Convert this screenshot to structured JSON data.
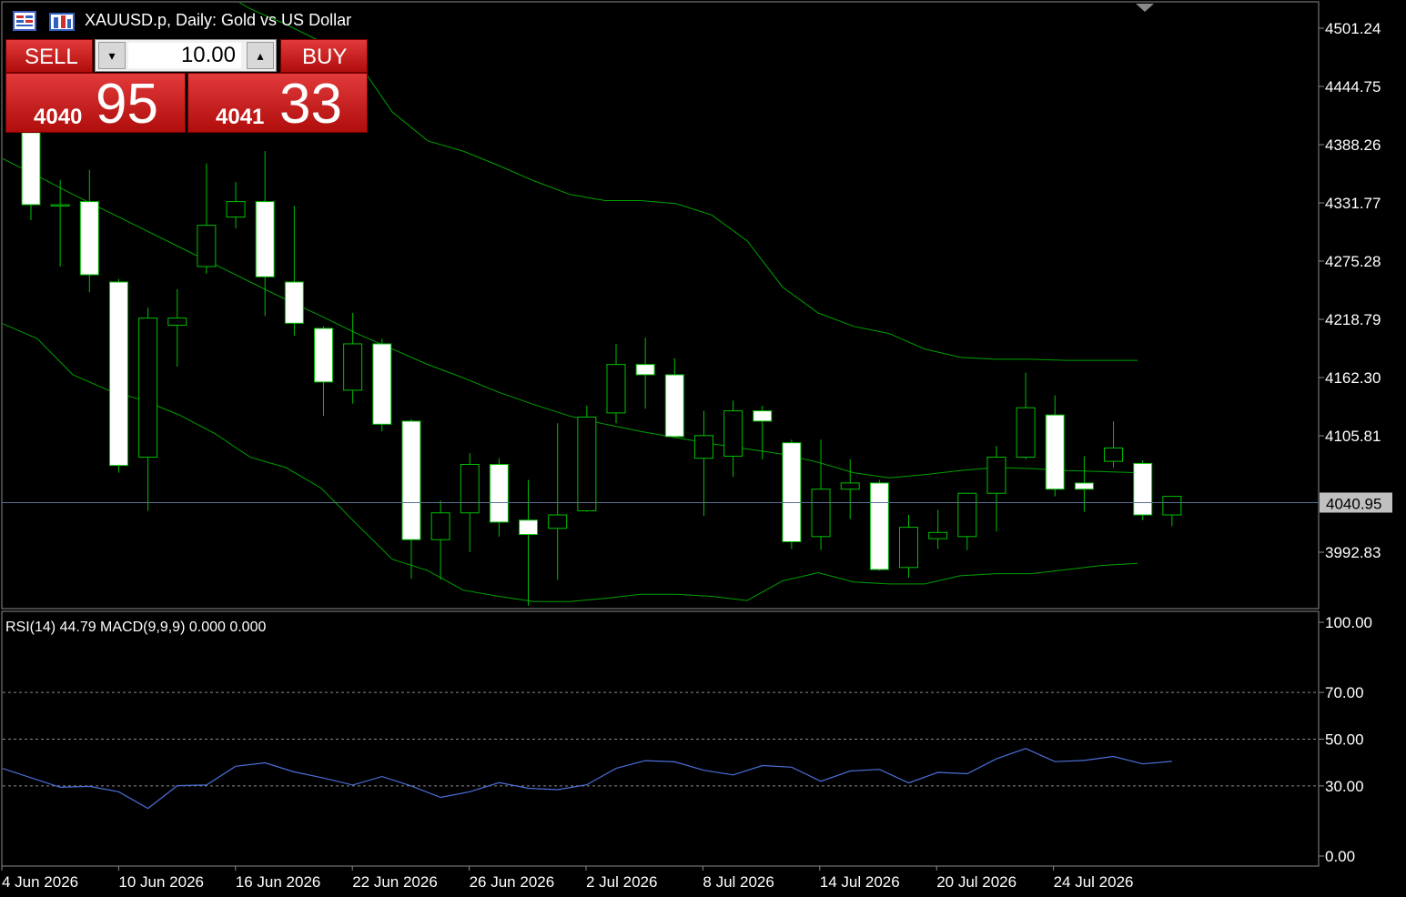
{
  "header": {
    "title": "XAUUSD.p, Daily:  Gold vs US Dollar"
  },
  "trade_panel": {
    "sell_label": "SELL",
    "buy_label": "BUY",
    "lot_value": "10.00",
    "sell_price_small": "4040",
    "sell_price_big": "95",
    "buy_price_small": "4041",
    "buy_price_big": "33"
  },
  "indicator": {
    "label": "RSI(14) 44.79 MACD(9,9,9) 0.000 0.000"
  },
  "colors": {
    "background": "#000000",
    "candle_bull": "#000000",
    "candle_bear": "#ffffff",
    "candle_outline": "#00c000",
    "bands": "#00a000",
    "rsi": "#4a6fd8",
    "current_price_line": "#5a6f8f",
    "trade_button": "#c81e1e"
  },
  "chart_data": [
    {
      "type": "candlestick",
      "title": "XAUUSD.p, Daily:  Gold vs US Dollar",
      "y_ticks": [
        "4501.24",
        "4444.75",
        "4388.26",
        "4331.77",
        "4275.28",
        "4218.79",
        "4162.30",
        "4105.81",
        "3992.83"
      ],
      "ylim": [
        3939,
        4517
      ],
      "x_ticks": [
        "4 Jun 2026",
        "10 Jun 2026",
        "16 Jun 2026",
        "22 Jun 2026",
        "26 Jun 2026",
        "2 Jul 2026",
        "8 Jul 2026",
        "14 Jul 2026",
        "20 Jul 2026",
        "24 Jul 2026"
      ],
      "current_price": 4040.95,
      "current_price_label": "4040.95",
      "candles": [
        {
          "o": 4400,
          "h": 4420,
          "l": 4315,
          "c": 4330
        },
        {
          "o": 4330,
          "h": 4354,
          "l": 4270,
          "c": 4330
        },
        {
          "o": 4333,
          "h": 4364,
          "l": 4245,
          "c": 4262
        },
        {
          "o": 4255,
          "h": 4258,
          "l": 4070,
          "c": 4077
        },
        {
          "o": 4085,
          "h": 4230,
          "l": 4033,
          "c": 4220
        },
        {
          "o": 4213,
          "h": 4248,
          "l": 4173,
          "c": 4220
        },
        {
          "o": 4270,
          "h": 4370,
          "l": 4263,
          "c": 4310
        },
        {
          "o": 4318,
          "h": 4352,
          "l": 4307,
          "c": 4333
        },
        {
          "o": 4333,
          "h": 4382,
          "l": 4222,
          "c": 4260
        },
        {
          "o": 4255,
          "h": 4329,
          "l": 4203,
          "c": 4215
        },
        {
          "o": 4210,
          "h": 4212,
          "l": 4125,
          "c": 4158
        },
        {
          "o": 4150,
          "h": 4225,
          "l": 4137,
          "c": 4195
        },
        {
          "o": 4195,
          "h": 4200,
          "l": 4110,
          "c": 4117
        },
        {
          "o": 4120,
          "h": 4122,
          "l": 3967,
          "c": 4005
        },
        {
          "o": 4005,
          "h": 4043,
          "l": 3966,
          "c": 4031
        },
        {
          "o": 4031,
          "h": 4089,
          "l": 3993,
          "c": 4078
        },
        {
          "o": 4078,
          "h": 4084,
          "l": 4008,
          "c": 4022
        },
        {
          "o": 4024,
          "h": 4063,
          "l": 3941,
          "c": 4010
        },
        {
          "o": 4016,
          "h": 4118,
          "l": 3966,
          "c": 4029
        },
        {
          "o": 4033,
          "h": 4135,
          "l": 4032,
          "c": 4124
        },
        {
          "o": 4128,
          "h": 4195,
          "l": 4118,
          "c": 4175
        },
        {
          "o": 4175,
          "h": 4201,
          "l": 4132,
          "c": 4165
        },
        {
          "o": 4165,
          "h": 4181,
          "l": 4110,
          "c": 4105
        },
        {
          "o": 4084,
          "h": 4130,
          "l": 4028,
          "c": 4106
        },
        {
          "o": 4086,
          "h": 4140,
          "l": 4066,
          "c": 4130
        },
        {
          "o": 4130,
          "h": 4135,
          "l": 4083,
          "c": 4120
        },
        {
          "o": 4099,
          "h": 4102,
          "l": 3996,
          "c": 4003
        },
        {
          "o": 4008,
          "h": 4102,
          "l": 3995,
          "c": 4054
        },
        {
          "o": 4054,
          "h": 4083,
          "l": 4025,
          "c": 4060
        },
        {
          "o": 4060,
          "h": 4063,
          "l": 3975,
          "c": 3976
        },
        {
          "o": 3978,
          "h": 4029,
          "l": 3968,
          "c": 4017
        },
        {
          "o": 4006,
          "h": 4034,
          "l": 3996,
          "c": 4012
        },
        {
          "o": 4008,
          "h": 4043,
          "l": 3995,
          "c": 4050
        },
        {
          "o": 4050,
          "h": 4096,
          "l": 4013,
          "c": 4085
        },
        {
          "o": 4085,
          "h": 4167,
          "l": 4083,
          "c": 4133
        },
        {
          "o": 4126,
          "h": 4145,
          "l": 4047,
          "c": 4054
        },
        {
          "o": 4060,
          "h": 4086,
          "l": 4032,
          "c": 4054
        },
        {
          "o": 4081,
          "h": 4120,
          "l": 4075,
          "c": 4094
        },
        {
          "o": 4079,
          "h": 4082,
          "l": 4024,
          "c": 4029
        },
        {
          "o": 4029,
          "h": 4046,
          "l": 4018,
          "c": 4047
        }
      ],
      "band_upper": [
        4615,
        4610,
        4600,
        4590,
        4575,
        4560,
        4540,
        4520,
        4505,
        4488,
        4470,
        4420,
        4392,
        4382,
        4368,
        4353,
        4340,
        4334,
        4334,
        4331,
        4320,
        4295,
        4250,
        4225,
        4212,
        4205,
        4190,
        4182,
        4180,
        4180,
        4179,
        4179,
        4179
      ],
      "band_middle": [
        4375,
        4358,
        4340,
        4323,
        4306,
        4289,
        4272,
        4255,
        4238,
        4222,
        4205,
        4190,
        4175,
        4162,
        4148,
        4136,
        4125,
        4117,
        4110,
        4104,
        4098,
        4093,
        4088,
        4080,
        4070,
        4065,
        4068,
        4072,
        4075,
        4074,
        4072,
        4071,
        4070
      ],
      "band_lower": [
        4215,
        4200,
        4165,
        4150,
        4140,
        4126,
        4108,
        4085,
        4075,
        4055,
        4020,
        3986,
        3975,
        3956,
        3950,
        3945,
        3945,
        3948,
        3952,
        3952,
        3950,
        3946,
        3965,
        3973,
        3964,
        3962,
        3962,
        3970,
        3972,
        3972,
        3976,
        3980,
        3982
      ],
      "band_x_start": 22
    },
    {
      "type": "line",
      "title": "RSI(14) 44.79 MACD(9,9,9) 0.000 0.000",
      "y_ticks": [
        "100.00",
        "70.00",
        "50.00",
        "30.00",
        "0.00"
      ],
      "ylim": [
        0,
        100
      ],
      "levels": [
        70,
        50,
        30
      ],
      "series": [
        {
          "values": [
            37.6,
            29.4,
            29.8,
            27.5,
            20.4,
            30.1,
            30.4,
            38.4,
            39.9,
            36.0,
            33.4,
            30.4,
            34.0,
            30.0,
            25.1,
            27.5,
            31.4,
            29.0,
            28.4,
            30.5,
            37.5,
            40.8,
            40.3,
            36.7,
            34.7,
            38.7,
            38.0,
            32.0,
            36.4,
            37.1,
            31.3,
            35.8,
            35.2,
            41.6,
            46.0,
            40.4,
            40.9,
            42.6,
            39.4,
            40.5
          ]
        }
      ]
    }
  ]
}
